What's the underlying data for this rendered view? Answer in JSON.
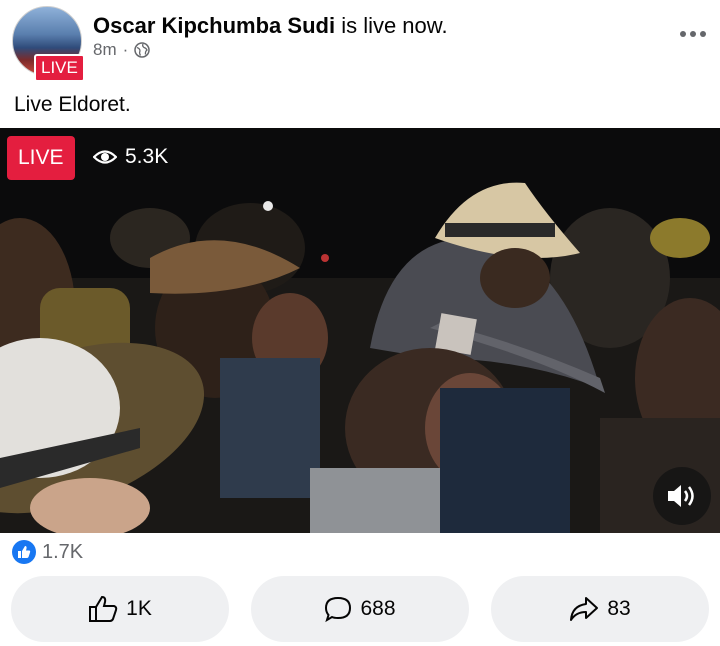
{
  "post": {
    "author": "Oscar Kipchumba Sudi",
    "status_text": "is live now.",
    "time": "8m",
    "separator": "·",
    "avatar_badge": "LIVE",
    "caption": "Live Eldoret."
  },
  "video": {
    "live_label": "LIVE",
    "viewers": "5.3K"
  },
  "reactions": {
    "count": "1.7K"
  },
  "actions": {
    "like_count": "1K",
    "comment_count": "688",
    "share_count": "83"
  },
  "colors": {
    "live_red": "#e41e3f",
    "facebook_blue": "#1877f2",
    "button_gray": "#eff0f2"
  },
  "icons": [
    "globe-icon",
    "more-options-icon",
    "eye-icon",
    "sound-icon",
    "like-reaction-icon",
    "thumbs-up-icon",
    "comment-icon",
    "share-icon"
  ]
}
